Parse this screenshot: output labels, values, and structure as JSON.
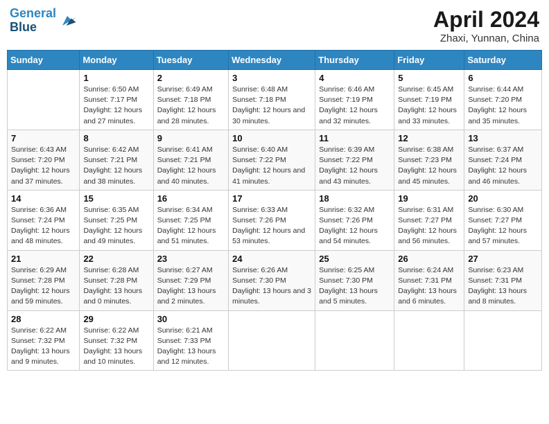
{
  "header": {
    "logo_line1": "General",
    "logo_line2": "Blue",
    "title": "April 2024",
    "subtitle": "Zhaxi, Yunnan, China"
  },
  "weekdays": [
    "Sunday",
    "Monday",
    "Tuesday",
    "Wednesday",
    "Thursday",
    "Friday",
    "Saturday"
  ],
  "weeks": [
    [
      {
        "num": "",
        "info": ""
      },
      {
        "num": "1",
        "info": "Sunrise: 6:50 AM\nSunset: 7:17 PM\nDaylight: 12 hours\nand 27 minutes."
      },
      {
        "num": "2",
        "info": "Sunrise: 6:49 AM\nSunset: 7:18 PM\nDaylight: 12 hours\nand 28 minutes."
      },
      {
        "num": "3",
        "info": "Sunrise: 6:48 AM\nSunset: 7:18 PM\nDaylight: 12 hours\nand 30 minutes."
      },
      {
        "num": "4",
        "info": "Sunrise: 6:46 AM\nSunset: 7:19 PM\nDaylight: 12 hours\nand 32 minutes."
      },
      {
        "num": "5",
        "info": "Sunrise: 6:45 AM\nSunset: 7:19 PM\nDaylight: 12 hours\nand 33 minutes."
      },
      {
        "num": "6",
        "info": "Sunrise: 6:44 AM\nSunset: 7:20 PM\nDaylight: 12 hours\nand 35 minutes."
      }
    ],
    [
      {
        "num": "7",
        "info": "Sunrise: 6:43 AM\nSunset: 7:20 PM\nDaylight: 12 hours\nand 37 minutes."
      },
      {
        "num": "8",
        "info": "Sunrise: 6:42 AM\nSunset: 7:21 PM\nDaylight: 12 hours\nand 38 minutes."
      },
      {
        "num": "9",
        "info": "Sunrise: 6:41 AM\nSunset: 7:21 PM\nDaylight: 12 hours\nand 40 minutes."
      },
      {
        "num": "10",
        "info": "Sunrise: 6:40 AM\nSunset: 7:22 PM\nDaylight: 12 hours\nand 41 minutes."
      },
      {
        "num": "11",
        "info": "Sunrise: 6:39 AM\nSunset: 7:22 PM\nDaylight: 12 hours\nand 43 minutes."
      },
      {
        "num": "12",
        "info": "Sunrise: 6:38 AM\nSunset: 7:23 PM\nDaylight: 12 hours\nand 45 minutes."
      },
      {
        "num": "13",
        "info": "Sunrise: 6:37 AM\nSunset: 7:24 PM\nDaylight: 12 hours\nand 46 minutes."
      }
    ],
    [
      {
        "num": "14",
        "info": "Sunrise: 6:36 AM\nSunset: 7:24 PM\nDaylight: 12 hours\nand 48 minutes."
      },
      {
        "num": "15",
        "info": "Sunrise: 6:35 AM\nSunset: 7:25 PM\nDaylight: 12 hours\nand 49 minutes."
      },
      {
        "num": "16",
        "info": "Sunrise: 6:34 AM\nSunset: 7:25 PM\nDaylight: 12 hours\nand 51 minutes."
      },
      {
        "num": "17",
        "info": "Sunrise: 6:33 AM\nSunset: 7:26 PM\nDaylight: 12 hours\nand 53 minutes."
      },
      {
        "num": "18",
        "info": "Sunrise: 6:32 AM\nSunset: 7:26 PM\nDaylight: 12 hours\nand 54 minutes."
      },
      {
        "num": "19",
        "info": "Sunrise: 6:31 AM\nSunset: 7:27 PM\nDaylight: 12 hours\nand 56 minutes."
      },
      {
        "num": "20",
        "info": "Sunrise: 6:30 AM\nSunset: 7:27 PM\nDaylight: 12 hours\nand 57 minutes."
      }
    ],
    [
      {
        "num": "21",
        "info": "Sunrise: 6:29 AM\nSunset: 7:28 PM\nDaylight: 12 hours\nand 59 minutes."
      },
      {
        "num": "22",
        "info": "Sunrise: 6:28 AM\nSunset: 7:28 PM\nDaylight: 13 hours\nand 0 minutes."
      },
      {
        "num": "23",
        "info": "Sunrise: 6:27 AM\nSunset: 7:29 PM\nDaylight: 13 hours\nand 2 minutes."
      },
      {
        "num": "24",
        "info": "Sunrise: 6:26 AM\nSunset: 7:30 PM\nDaylight: 13 hours\nand 3 minutes."
      },
      {
        "num": "25",
        "info": "Sunrise: 6:25 AM\nSunset: 7:30 PM\nDaylight: 13 hours\nand 5 minutes."
      },
      {
        "num": "26",
        "info": "Sunrise: 6:24 AM\nSunset: 7:31 PM\nDaylight: 13 hours\nand 6 minutes."
      },
      {
        "num": "27",
        "info": "Sunrise: 6:23 AM\nSunset: 7:31 PM\nDaylight: 13 hours\nand 8 minutes."
      }
    ],
    [
      {
        "num": "28",
        "info": "Sunrise: 6:22 AM\nSunset: 7:32 PM\nDaylight: 13 hours\nand 9 minutes."
      },
      {
        "num": "29",
        "info": "Sunrise: 6:22 AM\nSunset: 7:32 PM\nDaylight: 13 hours\nand 10 minutes."
      },
      {
        "num": "30",
        "info": "Sunrise: 6:21 AM\nSunset: 7:33 PM\nDaylight: 13 hours\nand 12 minutes."
      },
      {
        "num": "",
        "info": ""
      },
      {
        "num": "",
        "info": ""
      },
      {
        "num": "",
        "info": ""
      },
      {
        "num": "",
        "info": ""
      }
    ]
  ]
}
